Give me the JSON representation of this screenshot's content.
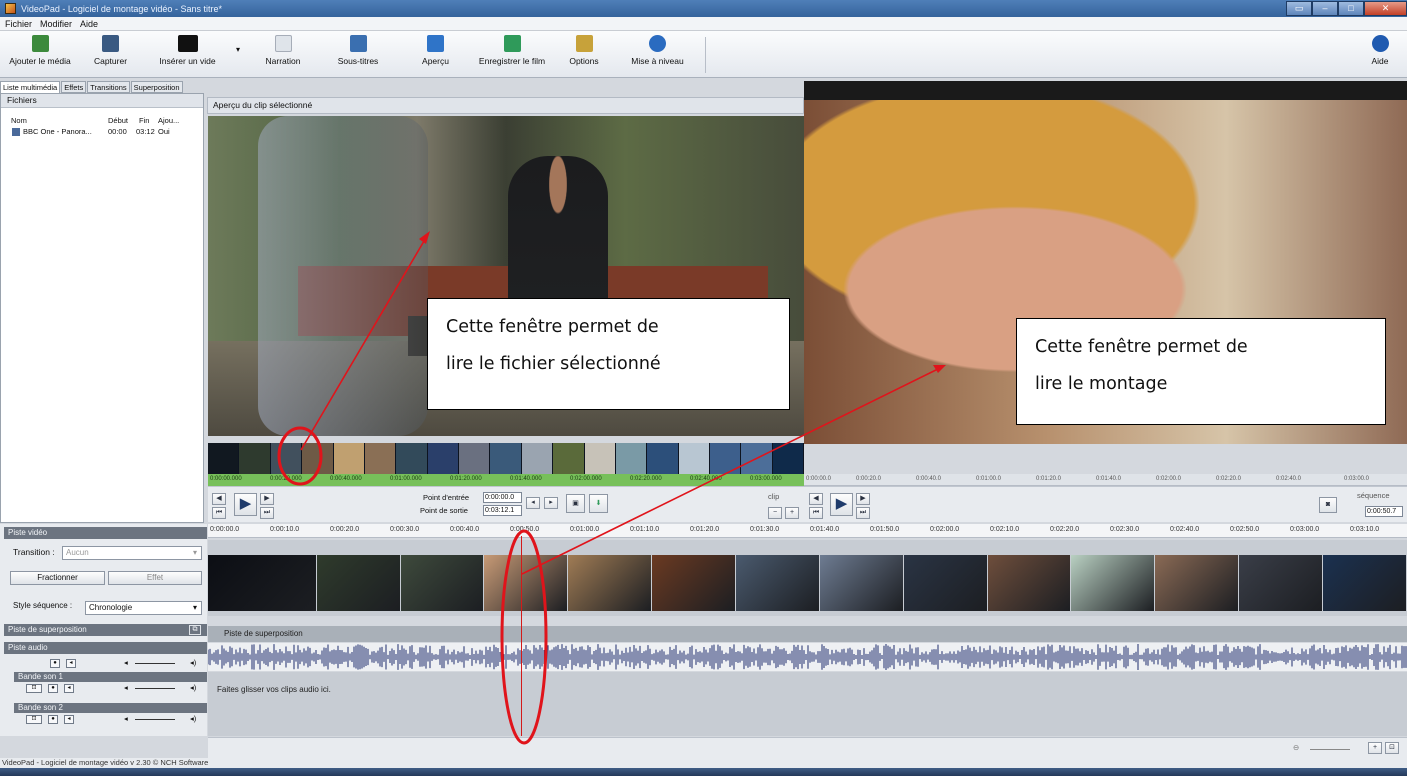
{
  "window": {
    "title": "VideoPad - Logiciel de montage vidéo - Sans titre*"
  },
  "menu": [
    "Fichier",
    "Modifier",
    "Aide"
  ],
  "toolbar": {
    "buttons": [
      {
        "label": "Ajouter le média",
        "icon": "add-media-icon",
        "color": "#3c8a3c"
      },
      {
        "label": "Capturer",
        "icon": "capture-icon",
        "color": "#3a5a82"
      },
      {
        "label": "Insérer un vide",
        "icon": "blank-clip-icon",
        "color": "#111111"
      },
      {
        "label": "Narration",
        "icon": "narration-icon",
        "color": "#d5dbe2"
      },
      {
        "label": "Sous-titres",
        "icon": "subtitles-icon",
        "color": "#3a6fb0"
      },
      {
        "label": "Aperçu",
        "icon": "preview-icon",
        "color": "#2f74c8"
      },
      {
        "label": "Enregistrer le film",
        "icon": "save-movie-icon",
        "color": "#2f9a5a"
      },
      {
        "label": "Options",
        "icon": "options-icon",
        "color": "#c7a23a"
      },
      {
        "label": "Mise à niveau",
        "icon": "upgrade-icon",
        "color": "#2a6bc0"
      },
      {
        "label": "Aide",
        "icon": "help-icon",
        "color": "#1f5ab0"
      }
    ]
  },
  "library": {
    "tabs": [
      "Liste multimédia",
      "Effets",
      "Transitions",
      "Superposition"
    ],
    "header": "Fichiers",
    "columns": [
      "Nom",
      "Début",
      "Fin",
      "Ajou..."
    ],
    "rows": [
      {
        "name": "BBC One - Panora...",
        "start": "00:00",
        "end": "03:12",
        "added": "Oui"
      }
    ]
  },
  "clip_preview": {
    "header": "Aperçu du clip sélectionné",
    "ruler": [
      "0:00:00.000",
      "0:00:20.000",
      "0:00:40.000",
      "0:01:00.000",
      "0:01:20.000",
      "0:01:40.000",
      "0:02:00.000",
      "0:02:20.000",
      "0:02:40.000",
      "0:03:00.000"
    ],
    "in_label": "Point d'entrée",
    "in_value": "0:00:00.0",
    "out_label": "Point de sortie",
    "out_value": "0:03:12.1",
    "mode_label": "clip"
  },
  "sequence_preview": {
    "ruler": [
      "0:00:00.0",
      "0:00:20.0",
      "0:00:40.0",
      "0:01:00.0",
      "0:01:20.0",
      "0:01:40.0",
      "0:02:00.0",
      "0:02:20.0",
      "0:02:40.0",
      "0:03:00.0"
    ],
    "mode_label": "séquence",
    "time_value": "0:00:50.7"
  },
  "timeline": {
    "ruler": [
      "0:00:00.0",
      "0:00:10.0",
      "0:00:20.0",
      "0:00:30.0",
      "0:00:40.0",
      "0:00:50.0",
      "0:01:00.0",
      "0:01:10.0",
      "0:01:20.0",
      "0:01:30.0",
      "0:01:40.0",
      "0:01:50.0",
      "0:02:00.0",
      "0:02:10.0",
      "0:02:20.0",
      "0:02:30.0",
      "0:02:40.0",
      "0:02:50.0",
      "0:03:00.0",
      "0:03:10.0"
    ],
    "video_track_label": "Piste vidéo",
    "transition_label": "Transition :",
    "transition_value": "Aucun",
    "split_button": "Fractionner",
    "effect_button": "Effet",
    "sequence_style_label": "Style séquence :",
    "sequence_style_value": "Chronologie",
    "overlay_track_label": "Piste de superposition",
    "overlay_track_text": "Piste de superposition",
    "audio_track_label": "Piste audio",
    "soundtrack1_label": "Bande son 1",
    "soundtrack2_label": "Bande son 2",
    "drop_audio_hint": "Faites glisser vos clips audio ici."
  },
  "status": "VideoPad - Logiciel de montage vidéo v 2.30 © NCH Software",
  "callouts": {
    "clip": "Cette fenêtre permet de lire le fichier sélectionné",
    "clip_line1": "Cette fenêtre permet de",
    "clip_line2": "lire le fichier sélectionné",
    "sequence_line1": "Cette fenêtre permet de",
    "sequence_line2": "lire le montage"
  },
  "colors": {
    "annotation": "#e0141b",
    "accent": "#3a7bd5",
    "clip_ruler": "#77c05a"
  },
  "thumbnail_colors": [
    "#111820",
    "#2e3a2e",
    "#41505d",
    "#6e5a46",
    "#c0a070",
    "#8a6f55",
    "#324a5a",
    "#2a3f6a",
    "#6a7080",
    "#3a5a7a",
    "#9aa4b0",
    "#5a6a3a",
    "#c7c2b8",
    "#7a9aa6",
    "#2c4f7a",
    "#b8c6d2",
    "#3d5f8c",
    "#4c6e99",
    "#0f2a4a"
  ],
  "video_clip_colors": [
    "#0c0e14",
    "#2f3b2c",
    "#3e4a3c",
    "#c79a76",
    "#a07c55",
    "#6b3a22",
    "#4a5a6e",
    "#6e7c92",
    "#2a3444",
    "#6e4e3c",
    "#b9d0c2",
    "#8a6a55",
    "#3a3e48",
    "#1b3150"
  ]
}
